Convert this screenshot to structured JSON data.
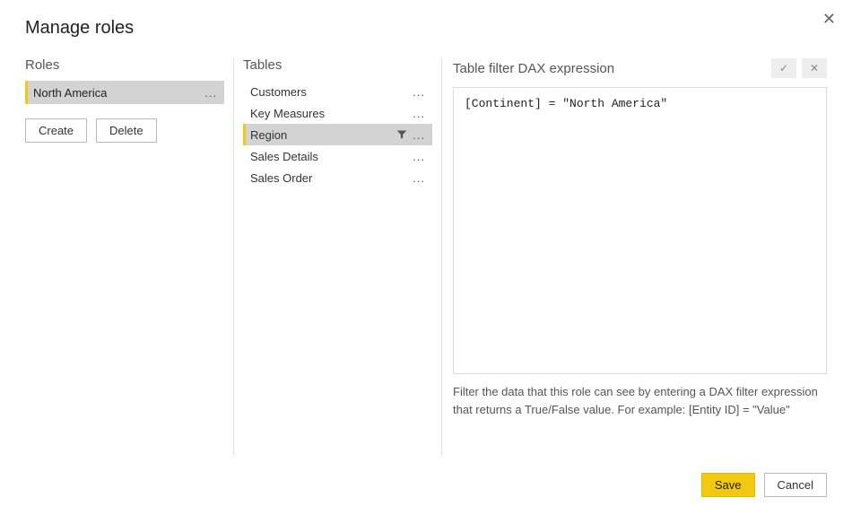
{
  "dialog": {
    "title": "Manage roles",
    "close_glyph": "✕"
  },
  "roles": {
    "header": "Roles",
    "items": [
      {
        "label": "North America",
        "selected": true
      }
    ],
    "create_label": "Create",
    "delete_label": "Delete",
    "ellipsis": "..."
  },
  "tables": {
    "header": "Tables",
    "items": [
      {
        "label": "Customers",
        "selected": false,
        "has_filter": false
      },
      {
        "label": "Key Measures",
        "selected": false,
        "has_filter": false
      },
      {
        "label": "Region",
        "selected": true,
        "has_filter": true
      },
      {
        "label": "Sales Details",
        "selected": false,
        "has_filter": false
      },
      {
        "label": "Sales Order",
        "selected": false,
        "has_filter": false
      }
    ],
    "ellipsis": "..."
  },
  "expression": {
    "header": "Table filter DAX expression",
    "accept_glyph": "✓",
    "reject_glyph": "✕",
    "value": "[Continent] = \"North America\"",
    "help_text": "Filter the data that this role can see by entering a DAX filter expression that returns a True/False value. For example: [Entity ID] = \"Value\""
  },
  "footer": {
    "save_label": "Save",
    "cancel_label": "Cancel"
  }
}
